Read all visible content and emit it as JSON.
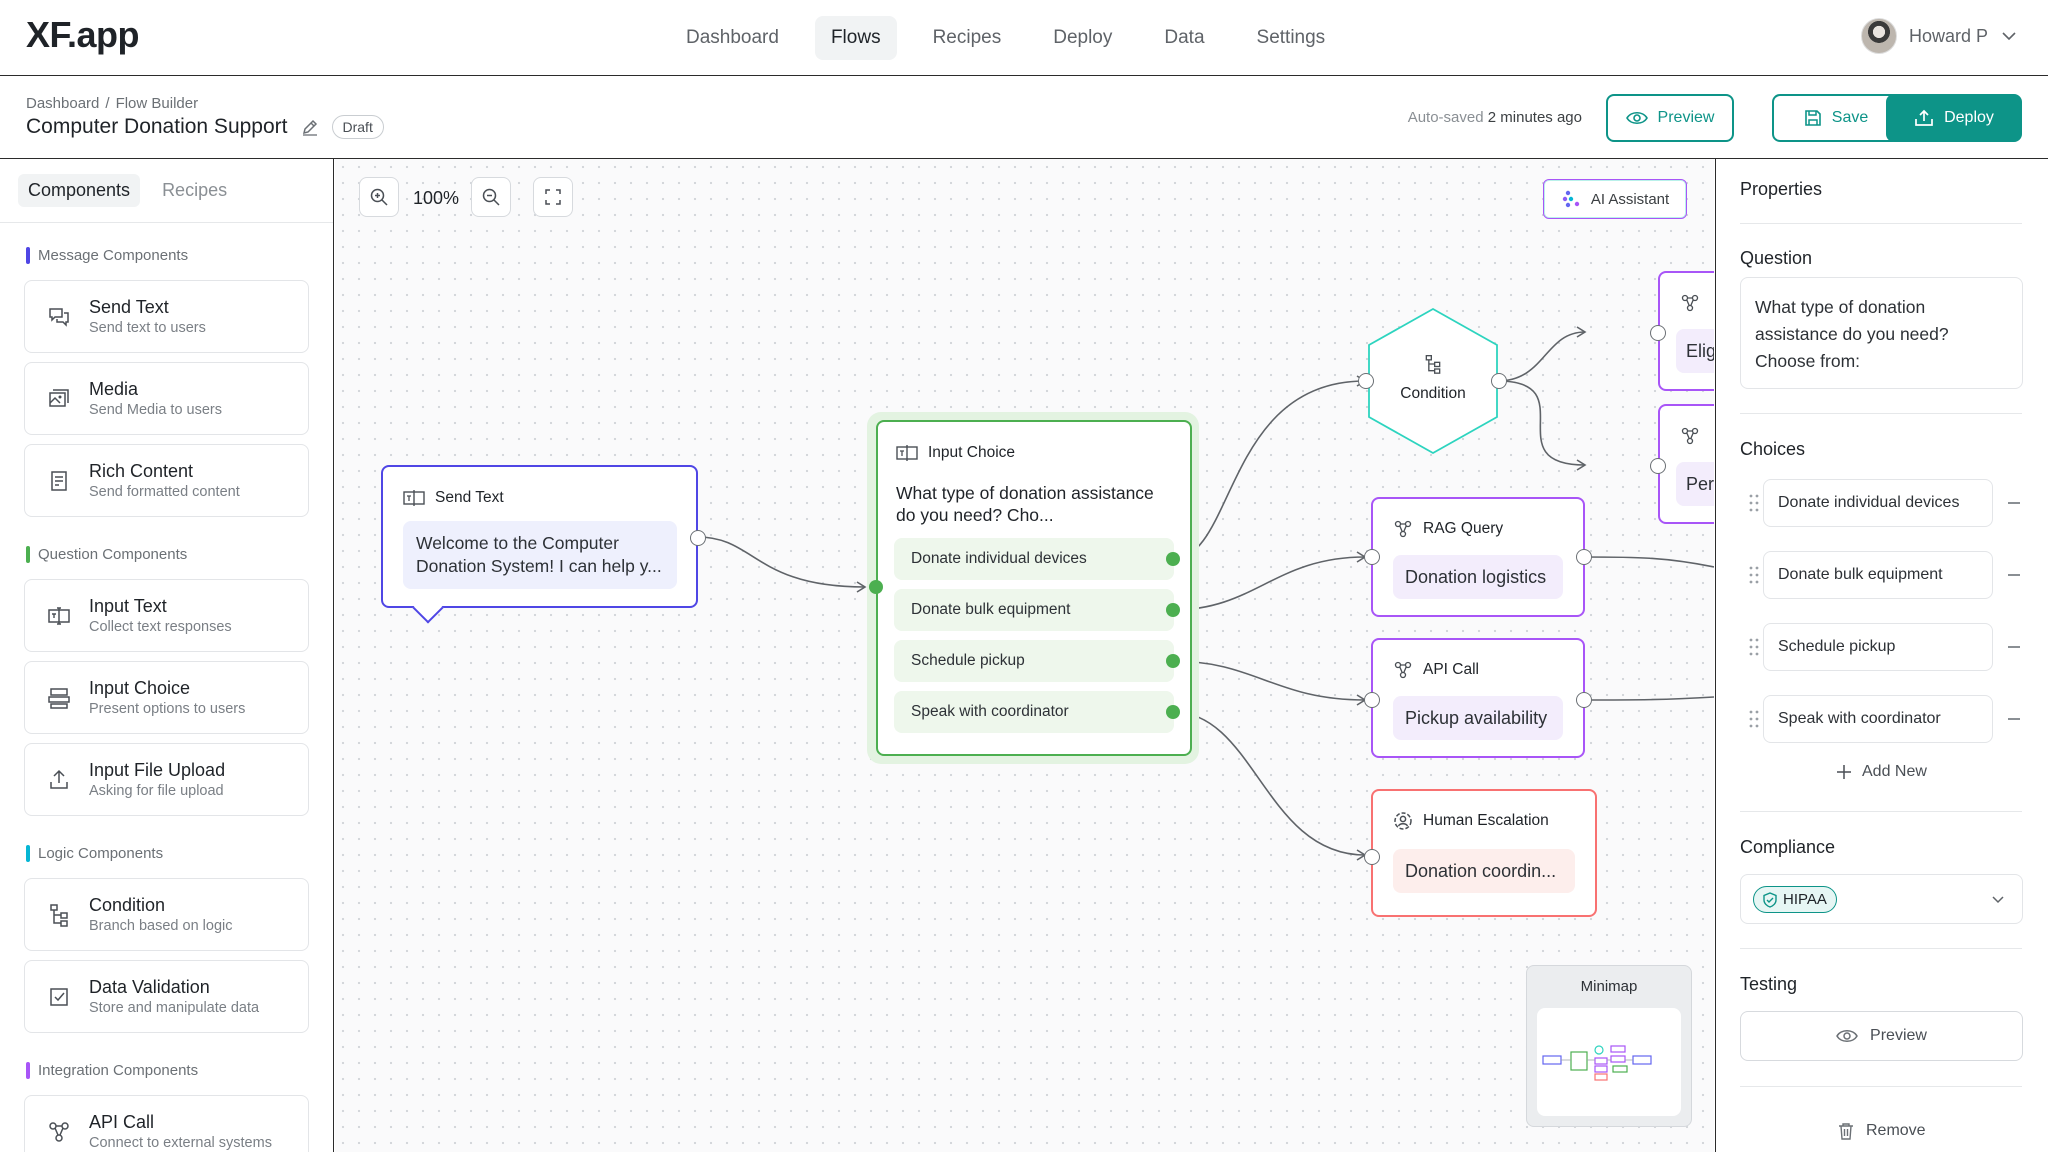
{
  "app": {
    "logo": "XF.app"
  },
  "nav": {
    "tabs": [
      "Dashboard",
      "Flows",
      "Recipes",
      "Deploy",
      "Data",
      "Settings"
    ],
    "active": "Flows",
    "user_name": "Howard P"
  },
  "header": {
    "breadcrumb": [
      "Dashboard",
      "Flow Builder"
    ],
    "breadcrumb_sep": "/",
    "title": "Computer Donation Support",
    "status_badge": "Draft",
    "autosave_prefix": "Auto-saved",
    "autosave_time": "2 minutes ago",
    "preview_label": "Preview",
    "save_label": "Save",
    "deploy_label": "Deploy"
  },
  "sidebar": {
    "tabs": [
      "Components",
      "Recipes"
    ],
    "active_tab": "Components",
    "sections": [
      {
        "label": "Message Components",
        "color": "#4f46e5",
        "items": [
          {
            "title": "Send Text",
            "subtitle": "Send text to users",
            "icon": "chat-bubbles-icon"
          },
          {
            "title": "Media",
            "subtitle": "Send Media to users",
            "icon": "images-icon"
          },
          {
            "title": "Rich Content",
            "subtitle": "Send formatted content",
            "icon": "document-icon"
          }
        ]
      },
      {
        "label": "Question Components",
        "color": "#4caf50",
        "items": [
          {
            "title": "Input Text",
            "subtitle": "Collect text responses",
            "icon": "text-input-icon"
          },
          {
            "title": "Input Choice",
            "subtitle": "Present options to users",
            "icon": "choice-icon"
          },
          {
            "title": "Input File Upload",
            "subtitle": "Asking for file upload",
            "icon": "upload-icon"
          }
        ]
      },
      {
        "label": "Logic Components",
        "color": "#06b6d4",
        "items": [
          {
            "title": "Condition",
            "subtitle": "Branch based on logic",
            "icon": "branch-icon"
          },
          {
            "title": "Data Validation",
            "subtitle": "Store and manipulate data",
            "icon": "validation-icon"
          }
        ]
      },
      {
        "label": "Integration Components",
        "color": "#a855f7",
        "items": [
          {
            "title": "API Call",
            "subtitle": "Connect to external systems",
            "icon": "api-icon"
          }
        ]
      }
    ]
  },
  "canvas": {
    "zoom": "100%",
    "ai_assistant_label": "AI Assistant",
    "minimap_label": "Minimap",
    "nodes": {
      "send_text": {
        "type": "Send Text",
        "message": "Welcome to the Computer Donation System! I can help y..."
      },
      "input_choice": {
        "type": "Input Choice",
        "question": "What type of donation assistance do you need? Cho...",
        "options": [
          "Donate individual devices",
          "Donate bulk equipment",
          "Schedule pickup",
          "Speak with coordinator"
        ]
      },
      "condition": {
        "type": "Condition"
      },
      "rag_query": {
        "type": "RAG Query",
        "value": "Donation logistics"
      },
      "api_call": {
        "type": "API Call",
        "value": "Pickup availability"
      },
      "human_escalation": {
        "type": "Human Escalation",
        "value": "Donation coordin..."
      },
      "partial_top": {
        "value": "Elig"
      },
      "partial_bottom": {
        "value": "Per"
      }
    }
  },
  "properties": {
    "title": "Properties",
    "question_label": "Question",
    "question_text": "What type of donation assistance do you need? Choose from:",
    "choices_label": "Choices",
    "choices": [
      "Donate individual devices",
      "Donate bulk equipment",
      "Schedule pickup",
      "Speak with coordinator"
    ],
    "add_new_label": "Add New",
    "compliance_label": "Compliance",
    "compliance_value": "HIPAA",
    "testing_label": "Testing",
    "testing_preview_label": "Preview",
    "remove_label": "Remove"
  },
  "colors": {
    "accent": "#0d9488",
    "input_choice_border": "#4caf50",
    "send_text_border": "#4f46e5",
    "condition_border": "#2dd4bf",
    "integration_border": "#a855f7",
    "escalation_border": "#f87171"
  }
}
